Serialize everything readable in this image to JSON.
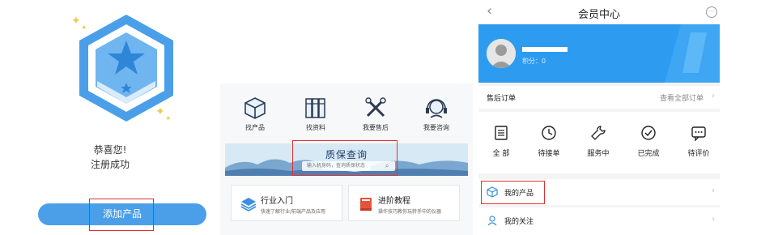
{
  "register": {
    "line1": "恭喜您!",
    "line2": "注册成功",
    "add_button": "添加产品"
  },
  "home": {
    "categories": [
      {
        "label": "找产品",
        "icon": "cube-icon"
      },
      {
        "label": "找资料",
        "icon": "books-icon"
      },
      {
        "label": "我要售后",
        "icon": "tools-icon"
      },
      {
        "label": "我要咨询",
        "icon": "headset-icon"
      }
    ],
    "banner_title": "质保查询",
    "search_placeholder": "输入机身码，查询质保状态",
    "cards": [
      {
        "title": "行业入门",
        "subtitle": "快速了解行业/前端产品及应用",
        "icon": "layers-icon"
      },
      {
        "title": "进阶教程",
        "subtitle": "操作技巧教你玩转手中的仪器",
        "icon": "book-icon"
      }
    ]
  },
  "member": {
    "title": "会员中心",
    "points_label": "积分：0",
    "orders_label": "售后订单",
    "view_all": "查看全部订单",
    "statuses": [
      {
        "label": "全 部",
        "icon": "list-icon"
      },
      {
        "label": "待接单",
        "icon": "clock-icon"
      },
      {
        "label": "服务中",
        "icon": "wrench-icon"
      },
      {
        "label": "已完成",
        "icon": "check-circle-icon"
      },
      {
        "label": "待评价",
        "icon": "comment-icon"
      }
    ],
    "my_products": "我的产品",
    "my_follows": "我的关注"
  },
  "colors": {
    "accent": "#4a9fe8",
    "hero_blue": "#2d9cf0",
    "highlight_red": "#e03030"
  }
}
